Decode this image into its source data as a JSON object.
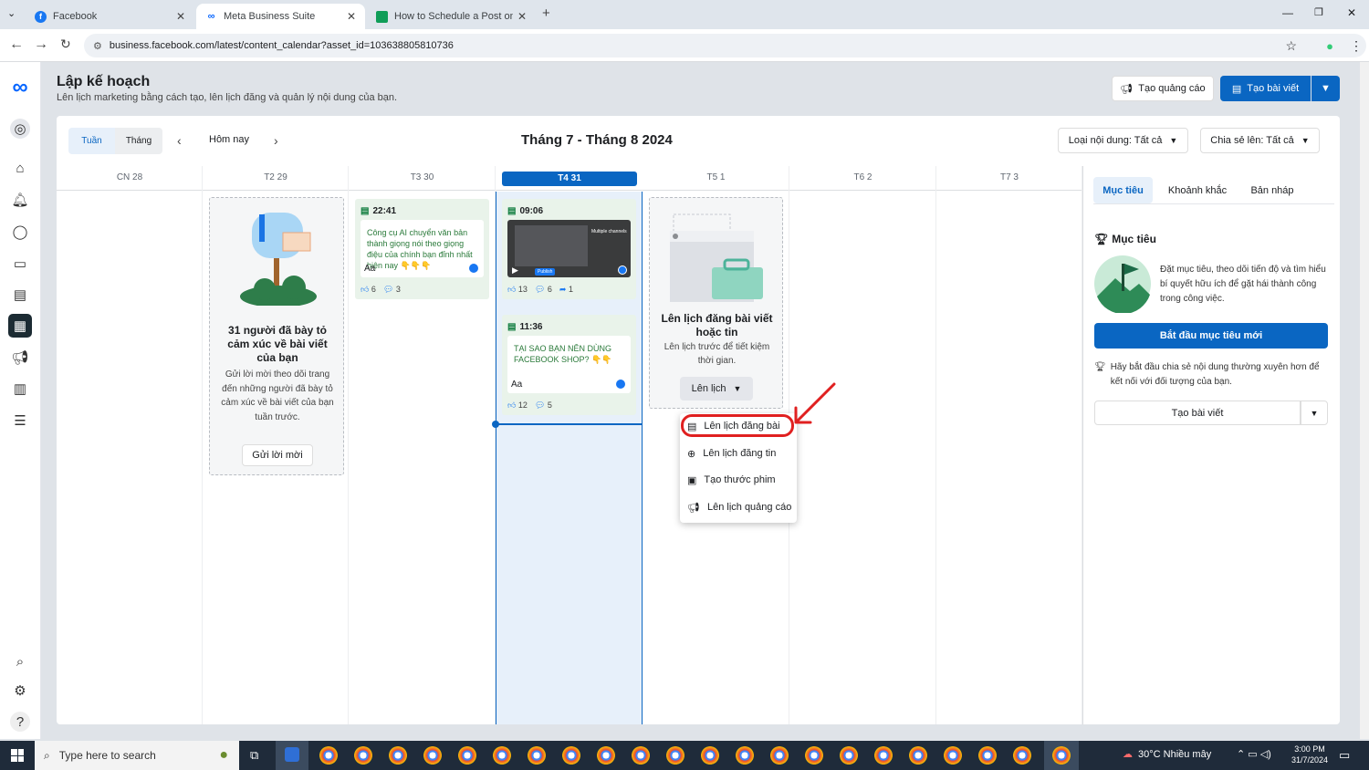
{
  "browser": {
    "tabs": [
      {
        "label": "Facebook"
      },
      {
        "label": "Meta Business Suite"
      },
      {
        "label": "How to Schedule a Post on Fac"
      }
    ],
    "url": "business.facebook.com/latest/content_calendar?asset_id=103638805810736"
  },
  "page": {
    "title": "Lập kế hoạch",
    "subtitle": "Lên lịch marketing bằng cách tạo, lên lịch đăng và quản lý nội dung của bạn.",
    "create_ad": "Tạo quảng cáo",
    "create_post": "Tạo bài viết"
  },
  "toolbar": {
    "week": "Tuần",
    "month": "Tháng",
    "today": "Hôm nay",
    "range": "Tháng 7 - Tháng 8 2024",
    "filter_type": "Loại nội dung: Tất cả",
    "filter_share": "Chia sẻ lên: Tất cả"
  },
  "days": [
    {
      "label": "CN 28"
    },
    {
      "label": "T2 29"
    },
    {
      "label": "T3 30"
    },
    {
      "label": "T4 31"
    },
    {
      "label": "T5 1"
    },
    {
      "label": "T6 2"
    },
    {
      "label": "T7 3"
    }
  ],
  "reactions_card": {
    "title": "31 người đã bày tỏ cảm xúc về bài viết của bạn",
    "body": "Gửi lời mời theo dõi trang đến những người đã bày tỏ cảm xúc về bài viết của bạn tuần trước.",
    "button": "Gửi lời mời"
  },
  "posts": [
    {
      "time": "22:41",
      "text": "Công cụ AI chuyển văn bản thành giọng nói theo giọng điệu của chính bạn đỉnh nhất hiện nay 👇👇👇",
      "aa": "Aa",
      "likes": "6",
      "comments": "3"
    },
    {
      "time": "09:06",
      "badge": "Publish",
      "thumb_caption": "Multiple channels",
      "likes": "13",
      "comments": "6",
      "shares": "1"
    },
    {
      "time": "11:36",
      "text": "TẠI SAO BẠN NÊN DÙNG FACEBOOK SHOP? 👇👇",
      "aa": "Aa",
      "likes": "12",
      "comments": "5"
    }
  ],
  "schedule_card": {
    "title": "Lên lịch đăng bài viết hoặc tin",
    "body": "Lên lịch trước để tiết kiệm thời gian.",
    "button": "Lên lịch"
  },
  "dropdown": {
    "items": [
      {
        "label": "Lên lịch đăng bài"
      },
      {
        "label": "Lên lịch đăng tin"
      },
      {
        "label": "Tạo thước phim"
      },
      {
        "label": "Lên lịch quảng cáo"
      }
    ]
  },
  "right_panel": {
    "tabs": [
      "Mục tiêu",
      "Khoảnh khắc",
      "Bản nháp"
    ],
    "heading": "Mục tiêu",
    "desc": "Đặt mục tiêu, theo dõi tiến độ và tìm hiểu bí quyết hữu ích để gặt hái thành công trong công việc.",
    "start_button": "Bắt đầu mục tiêu mới",
    "tip": "Hãy bắt đầu chia sẻ nội dung thường xuyên hơn để kết nối với đối tượng của bạn.",
    "create_post": "Tạo bài viết"
  },
  "taskbar": {
    "search": "Type here to search",
    "weather": "30°C  Nhiều mây",
    "time": "3:00 PM",
    "date": "31/7/2024"
  },
  "colors": {
    "brand": "#0a66c2",
    "highlight_red": "#e02020",
    "selected_col": "#e7f0fa"
  }
}
